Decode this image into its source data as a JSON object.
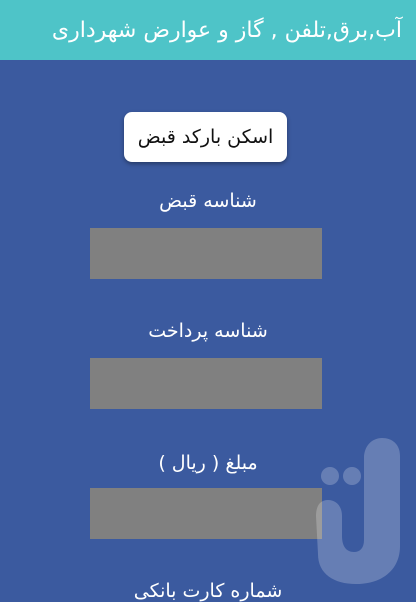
{
  "app_bar": {
    "title": "آب,برق,تلفن , گاز و عوارض شهرداری"
  },
  "scan_button": {
    "label": "اسکن بارکد قبض"
  },
  "fields": {
    "bill_id": {
      "label": "شناسه قبض",
      "value": ""
    },
    "payment_id": {
      "label": "شناسه پرداخت",
      "value": ""
    },
    "amount": {
      "label": "مبلغ ( ریال )",
      "value": ""
    },
    "card_number": {
      "label": "شماره کارت بانکی"
    }
  },
  "colors": {
    "app_bar": "#4ec4c8",
    "background": "#3b5a9f",
    "input": "#808080",
    "button": "#ffffff"
  },
  "icons": {
    "watermark": "bazaar-logo-icon"
  }
}
